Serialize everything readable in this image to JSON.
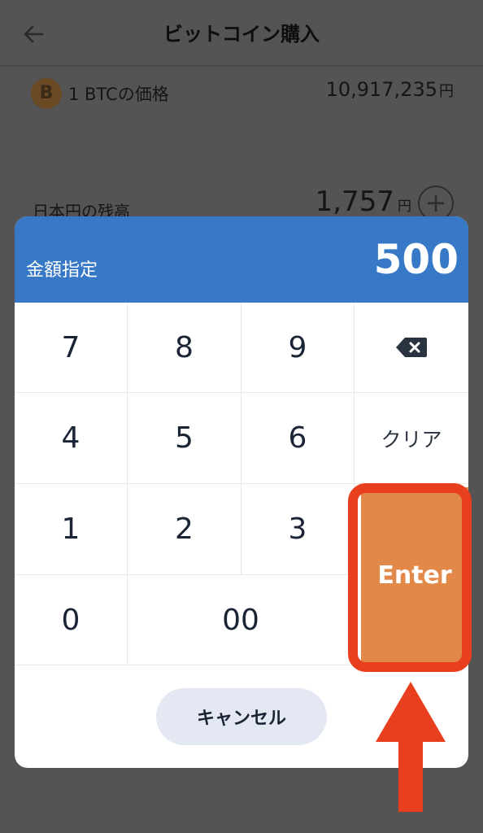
{
  "header": {
    "title": "ビットコイン購入",
    "back_icon": "arrow-left-icon"
  },
  "price": {
    "icon": "bitcoin-icon",
    "icon_symbol": "B",
    "label": "1 BTCの価格",
    "value": "10,917,235",
    "unit": "円"
  },
  "balance": {
    "label": "日本円の残高",
    "value": "1,757",
    "unit": "円",
    "add_icon": "plus-circle-icon",
    "add_symbol": "+"
  },
  "keypad": {
    "title": "金額指定",
    "amount": "500",
    "keys": {
      "k7": "7",
      "k8": "8",
      "k9": "9",
      "k4": "4",
      "k5": "5",
      "k6": "6",
      "k1": "1",
      "k2": "2",
      "k3": "3",
      "k0": "0",
      "k00": "00"
    },
    "clear_label": "クリア",
    "delete_icon": "backspace-icon",
    "enter_label": "Enter",
    "cancel_label": "キャンセル"
  },
  "colors": {
    "header_blue": "#3879c7",
    "enter_orange": "#e2894a",
    "highlight_red": "#e8401e",
    "cancel_bg": "#e3e8f2"
  }
}
